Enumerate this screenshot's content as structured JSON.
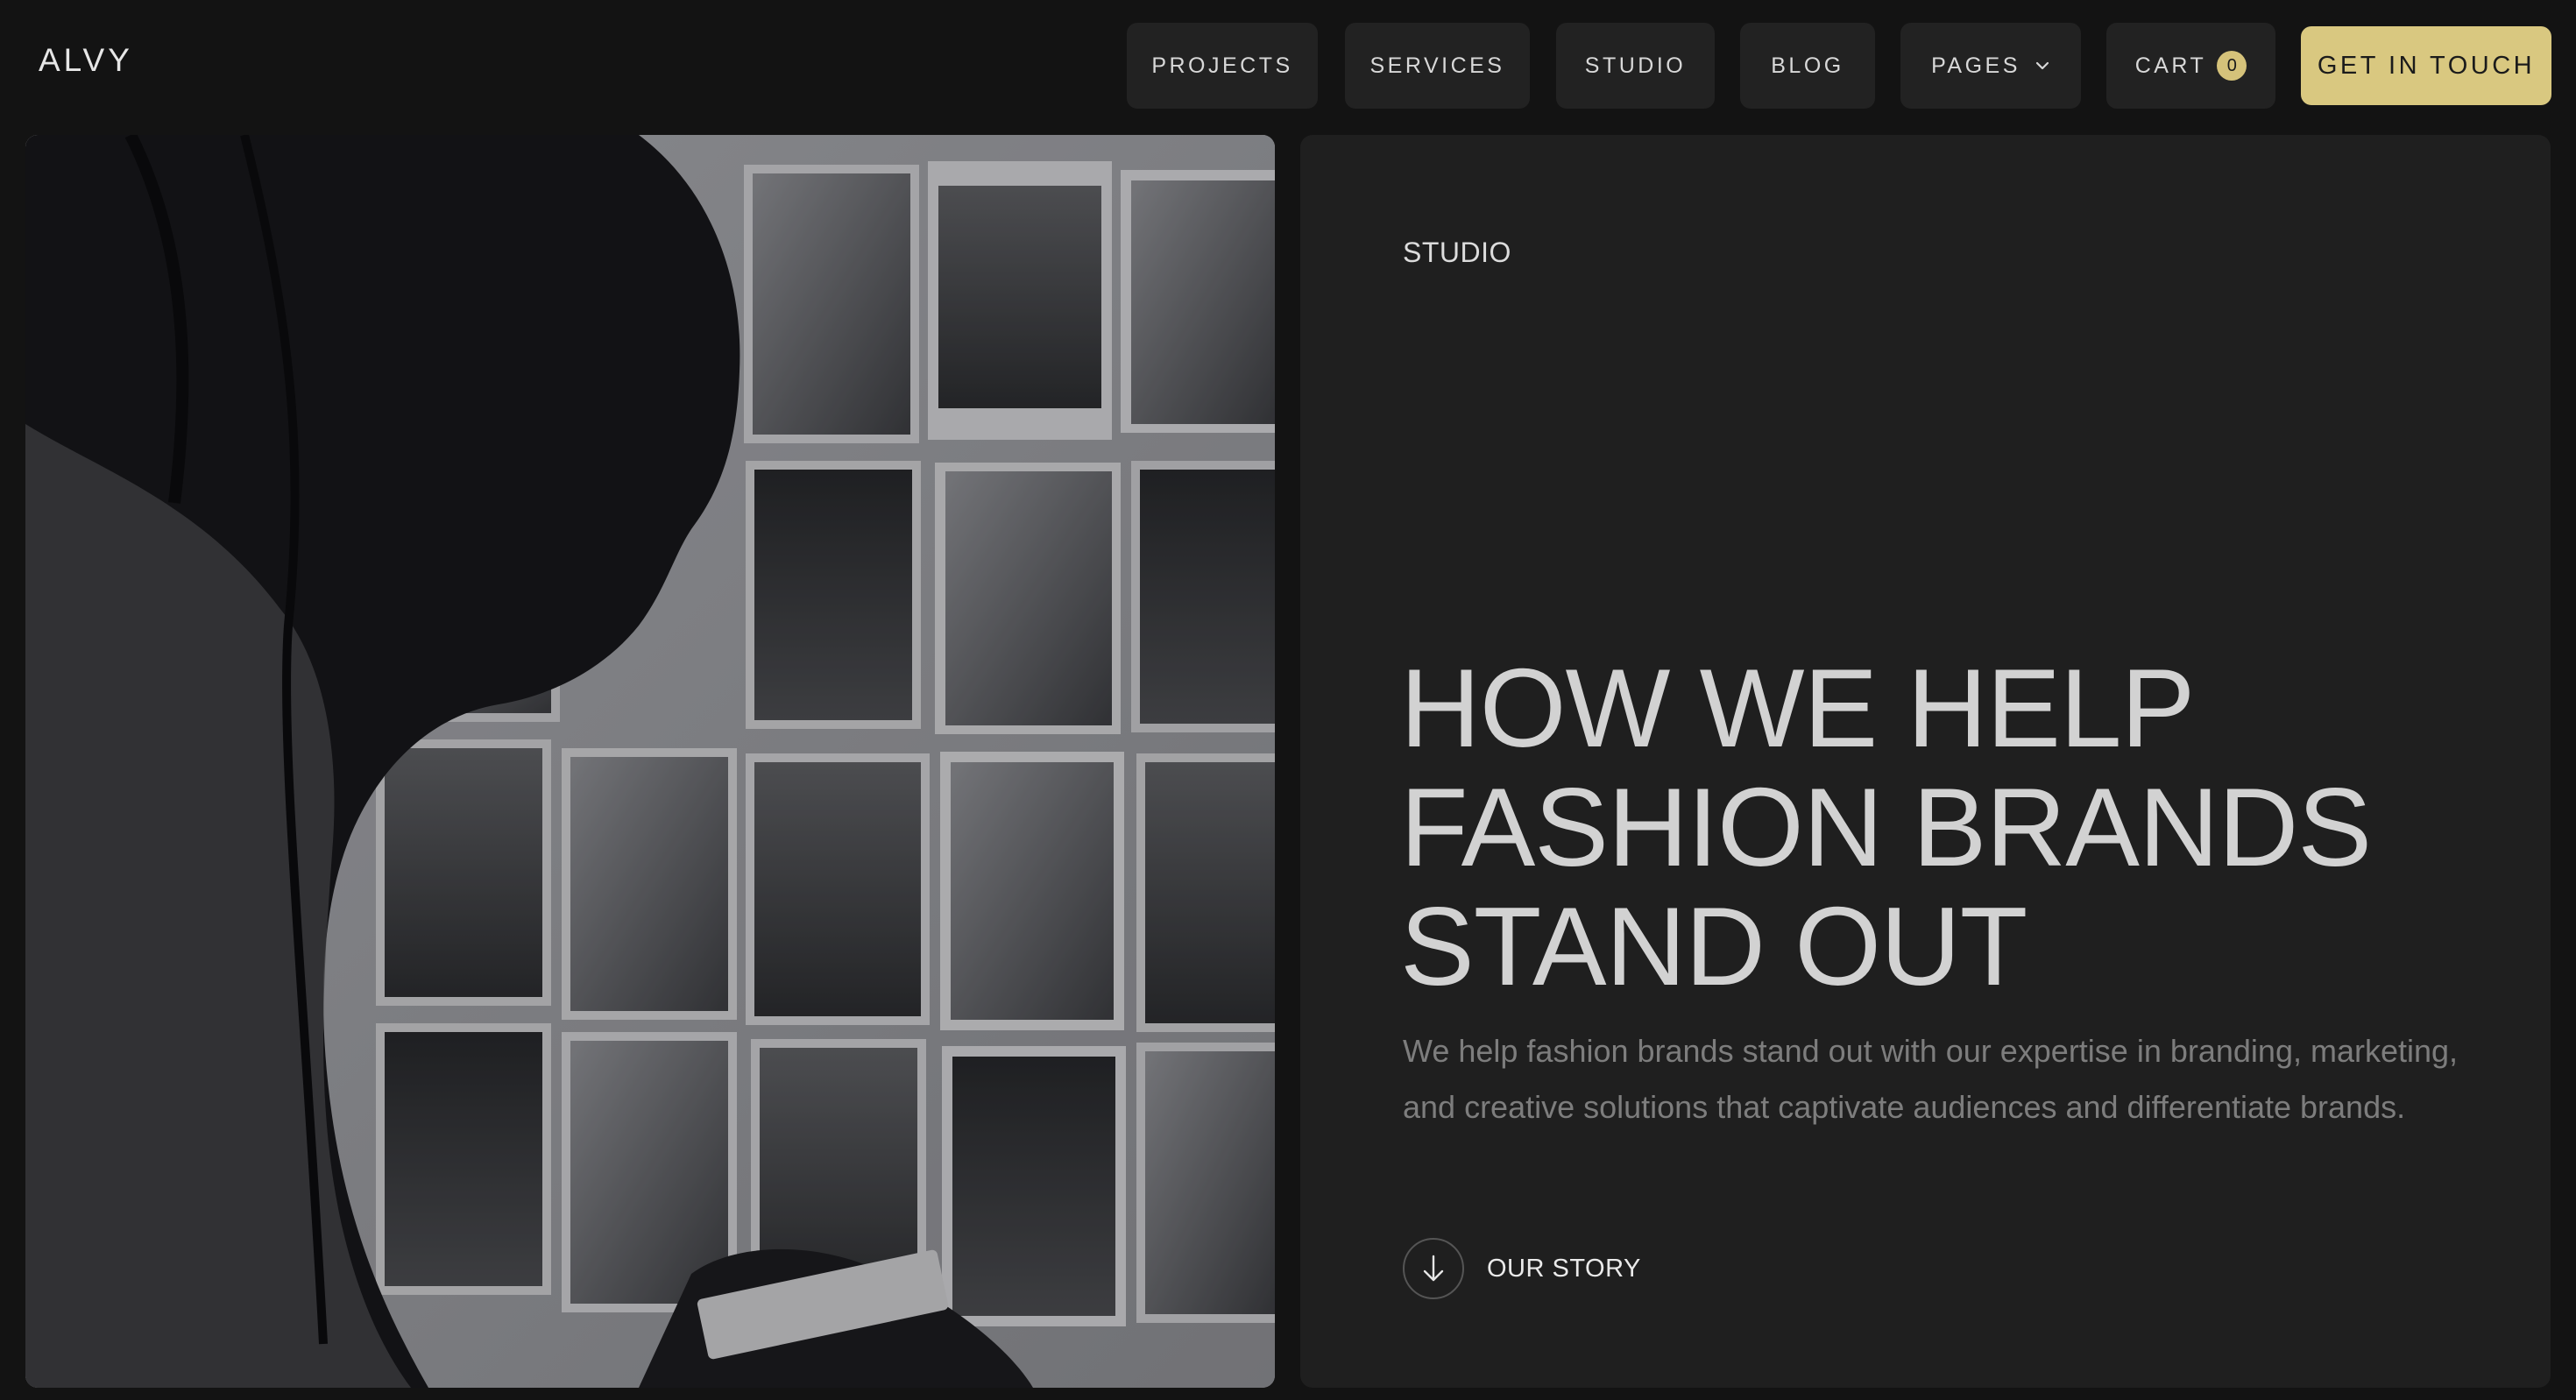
{
  "brand": {
    "logo": "ALVY"
  },
  "nav": {
    "items": [
      {
        "label": "PROJECTS"
      },
      {
        "label": "SERVICES"
      },
      {
        "label": "STUDIO"
      },
      {
        "label": "BLOG"
      },
      {
        "label": "PAGES"
      }
    ],
    "cart_label": "CART",
    "cart_count": "0",
    "cta_label": "GET IN TOUCH"
  },
  "hero": {
    "eyebrow": "STUDIO",
    "headline": [
      "HOW WE HELP",
      "FASHION BRANDS",
      "STAND OUT"
    ],
    "description": "We help fashion brands stand out with our expertise in branding, marketing, and creative solutions that captivate audiences and differentiate brands.",
    "story_label": "OUR STORY"
  },
  "icons": {
    "pages_dropdown": "chevron-down-icon",
    "story": "arrow-down-icon"
  },
  "colors": {
    "background": "#131313",
    "panel": "#1f1f1f",
    "nav_button": "#222222",
    "accent": "#d9c880"
  }
}
